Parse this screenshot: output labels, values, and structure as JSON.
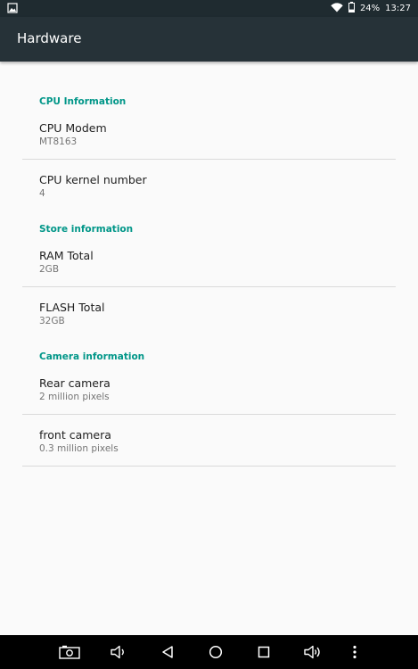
{
  "status_bar": {
    "battery": "24%",
    "time": "13:27"
  },
  "app_bar": {
    "title": "Hardware"
  },
  "sections": [
    {
      "title": "CPU Information",
      "items": [
        {
          "title": "CPU Modem",
          "value": "MT8163"
        },
        {
          "title": "CPU kernel number",
          "value": "4"
        }
      ]
    },
    {
      "title": "Store information",
      "items": [
        {
          "title": "RAM Total",
          "value": "2GB"
        },
        {
          "title": "FLASH Total",
          "value": "32GB"
        }
      ]
    },
    {
      "title": "Camera information",
      "items": [
        {
          "title": "Rear camera",
          "value": "2 million pixels"
        },
        {
          "title": "front camera",
          "value": "0.3 million pixels"
        }
      ]
    }
  ],
  "nav_bar": {
    "icons": [
      "screenshot-icon",
      "volume-down-icon",
      "back-icon",
      "home-icon",
      "recents-icon",
      "volume-up-icon",
      "more-vert-icon"
    ]
  },
  "colors": {
    "accent": "#009688",
    "app_bar": "#263238",
    "status_bar": "#1f2b30"
  }
}
